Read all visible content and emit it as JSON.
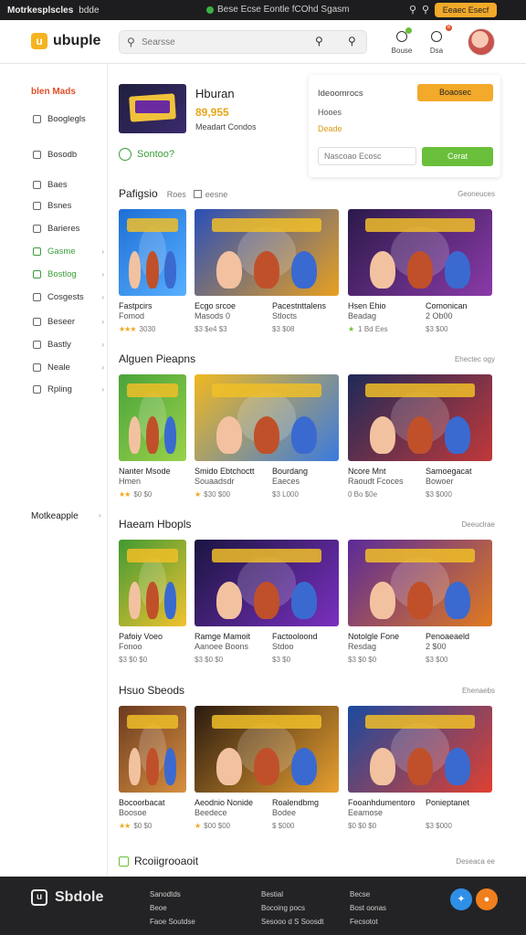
{
  "topbar": {
    "brand": "Motrkesplscles",
    "sub": "bdde",
    "notice": "Bese Ecse Eontle fCOhd Sgasm",
    "button": "Eeaec Esecf"
  },
  "header": {
    "logo_text": "ubuple",
    "search_placeholder": "Searsse",
    "icon1_label": "Bouse",
    "icon2_label": "Dsa",
    "badge2": "8"
  },
  "sidebar": {
    "heading": "blen Mads",
    "items": [
      {
        "label": "Booglegls",
        "chev": false,
        "green": false
      },
      {
        "label": "Bosodb",
        "chev": false,
        "green": false
      },
      {
        "label": "Baes",
        "chev": false,
        "green": false
      },
      {
        "label": "Bsnes",
        "chev": false,
        "green": false
      },
      {
        "label": "Barieres",
        "chev": false,
        "green": false
      },
      {
        "label": "Gasme",
        "chev": true,
        "green": true
      },
      {
        "label": "Bostlog",
        "chev": true,
        "green": true
      },
      {
        "label": "Cosgests",
        "chev": true,
        "green": false
      },
      {
        "label": "Beseer",
        "chev": true,
        "green": false
      },
      {
        "label": "Bastly",
        "chev": true,
        "green": false
      },
      {
        "label": "Neale",
        "chev": true,
        "green": false
      },
      {
        "label": "Rpling",
        "chev": true,
        "green": false
      }
    ],
    "footer_label": "Motkeapple"
  },
  "featured": {
    "title": "Hburan",
    "price": "89,955",
    "subtitle": "Meadart Condos",
    "action": "Sontoo?"
  },
  "panel": {
    "title": "Ideoomrocs",
    "button1": "Boaosec",
    "line1": "Hooes",
    "line2": "Deade",
    "input_placeholder": "Nascoao Ecosc",
    "button2": "Cerat"
  },
  "sections": [
    {
      "title": "Pafigsio",
      "extra": "Roes",
      "checkbox_label": "eesne",
      "more": "Geoneuces",
      "cards": [
        {
          "name": [
            "Fastpcirs",
            "Fomod"
          ],
          "meta": "3030",
          "stars": "★★★",
          "star_color": "gold"
        },
        {
          "name": [
            "Ecgo srcoe",
            "Masods 0"
          ],
          "meta": "$3 $e4 $3",
          "stars": "",
          "star_color": ""
        },
        {
          "name": [
            "Pacestnttalens",
            "Stlocts"
          ],
          "meta": "$3 $08",
          "stars": "",
          "star_color": ""
        },
        {
          "name": [
            "Hsen Ehio",
            "Beadag"
          ],
          "meta": "1 Bd Ees",
          "stars": "★",
          "star_color": "green"
        },
        {
          "name": [
            "Comonican",
            "2 Ob00"
          ],
          "meta": "$3 $00",
          "stars": "",
          "star_color": ""
        }
      ]
    },
    {
      "title": "Alguen Pieapns",
      "extra": "",
      "checkbox_label": "",
      "more": "Ehectec ogy",
      "cards": [
        {
          "name": [
            "Nanter Msode",
            "Hmen"
          ],
          "meta": "$0 $0",
          "stars": "★★",
          "star_color": "gold"
        },
        {
          "name": [
            "Smido Ebtchoctt",
            "Souaadsdr"
          ],
          "meta": "$30 $00",
          "stars": "★",
          "star_color": "gold"
        },
        {
          "name": [
            "Bourdang",
            "Eaeces"
          ],
          "meta": "$3 L000",
          "stars": "",
          "star_color": ""
        },
        {
          "name": [
            "Ncore Mnt",
            "Raoudt Fcoces"
          ],
          "meta": "0 Bo $0e",
          "stars": "",
          "star_color": ""
        },
        {
          "name": [
            "Samoegacat",
            "Bowoer"
          ],
          "meta": "$3 $000",
          "stars": "",
          "star_color": ""
        }
      ]
    },
    {
      "title": "Haeam Hbopls",
      "extra": "",
      "checkbox_label": "",
      "more": "Deeuclrae",
      "cards": [
        {
          "name": [
            "Pafoiy Voeo",
            "Fonoo"
          ],
          "meta": "$3 $0 $0",
          "stars": "",
          "star_color": ""
        },
        {
          "name": [
            "Ramge Mamoit",
            "Aanoee Boons"
          ],
          "meta": "$3 $0 $0",
          "stars": "",
          "star_color": ""
        },
        {
          "name": [
            "Factooloond",
            "Stdoo"
          ],
          "meta": "$3 $0",
          "stars": "",
          "star_color": ""
        },
        {
          "name": [
            "Notolgle Fone",
            "Resdag"
          ],
          "meta": "$3 $0 $0",
          "stars": "",
          "star_color": ""
        },
        {
          "name": [
            "Penoaeaeld",
            "2 $00"
          ],
          "meta": "$3 $00",
          "stars": "",
          "star_color": ""
        }
      ]
    },
    {
      "title": "Hsuo Sbeods",
      "extra": "",
      "checkbox_label": "",
      "more": "Ehenaebs",
      "cards": [
        {
          "name": [
            "Bocoorbacat",
            "Boosoe"
          ],
          "meta": "$0 $0",
          "stars": "★★",
          "star_color": "gold"
        },
        {
          "name": [
            "Aeodnio Nonide",
            "Beedece"
          ],
          "meta": "$00 $00",
          "stars": "★",
          "star_color": "gold"
        },
        {
          "name": [
            "Roalendbmg",
            "Bodee"
          ],
          "meta": "$ $000",
          "stars": "",
          "star_color": ""
        },
        {
          "name": [
            "Fooanhdumentoro",
            "Eeamose"
          ],
          "meta": "$0 $0 $0",
          "stars": "",
          "star_color": ""
        },
        {
          "name": [
            "Ponieptanet",
            ""
          ],
          "meta": "$3 $000",
          "stars": "",
          "star_color": ""
        }
      ]
    }
  ],
  "bottom_section": {
    "title": "Rcoiigrooaoit",
    "more": "Deseaca ee"
  },
  "footer": {
    "logo": "Sbdole",
    "col1": [
      "Sanodtds",
      "Beoe",
      "Faoe Soutdse"
    ],
    "col2": [
      "Bestial",
      "Bocoing pocs",
      "Sesooo d S Soosdt"
    ],
    "col3": [
      "Becse",
      "Bost oonas",
      "Fecsotot"
    ]
  },
  "colors": {
    "accent_orange": "#f3a92a",
    "accent_green": "#6abf3a",
    "footer_bg": "#232325"
  }
}
